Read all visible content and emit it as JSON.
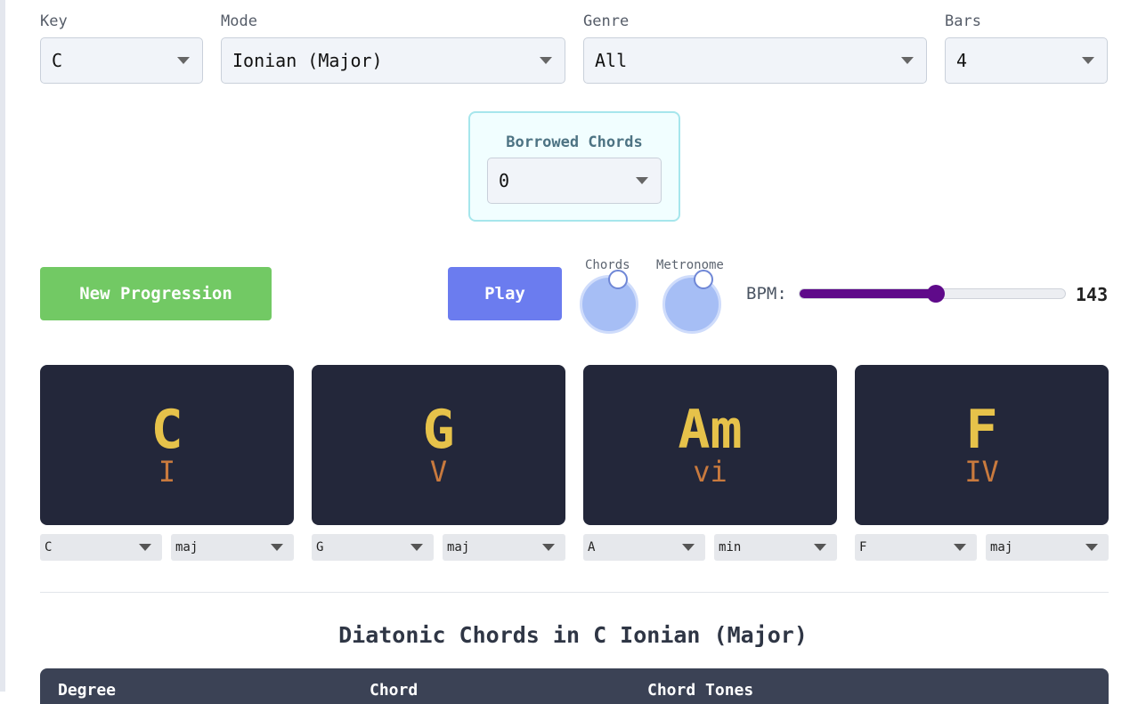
{
  "controls": {
    "key": {
      "label": "Key",
      "value": "C"
    },
    "mode": {
      "label": "Mode",
      "value": "Ionian (Major)"
    },
    "genre": {
      "label": "Genre",
      "value": "All"
    },
    "bars": {
      "label": "Bars",
      "value": "4"
    },
    "borrowed": {
      "label": "Borrowed Chords",
      "value": "0"
    }
  },
  "actions": {
    "new_progression": "New Progression",
    "play": "Play"
  },
  "toggles": {
    "chords": {
      "label": "Chords",
      "on": true
    },
    "metronome": {
      "label": "Metronome",
      "on": true
    }
  },
  "bpm": {
    "label": "BPM:",
    "value": "143",
    "min": 40,
    "max": 240
  },
  "chords": [
    {
      "name": "C",
      "degree": "I",
      "root": "C",
      "quality": "maj"
    },
    {
      "name": "G",
      "degree": "V",
      "root": "G",
      "quality": "maj"
    },
    {
      "name": "Am",
      "degree": "vi",
      "root": "A",
      "quality": "min"
    },
    {
      "name": "F",
      "degree": "IV",
      "root": "F",
      "quality": "maj"
    }
  ],
  "diatonic": {
    "title": "Diatonic Chords in C Ionian (Major)",
    "columns": [
      "Degree",
      "Chord",
      "Chord Tones"
    ]
  },
  "colors": {
    "new_progression": "#72c964",
    "play": "#6b7cef",
    "card_bg": "#23273a",
    "chord_name": "#e6c24a",
    "chord_degree": "#c97a3e",
    "slider": "#5f0a8a"
  }
}
